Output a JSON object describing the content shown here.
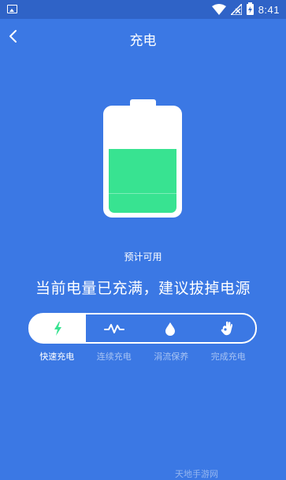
{
  "status_bar": {
    "time": "8:41",
    "icons": [
      "image-icon",
      "wifi-icon",
      "signal-icon",
      "battery-icon"
    ]
  },
  "header": {
    "title": "充电"
  },
  "battery": {
    "level": 0.62,
    "fill_color": "#38e391",
    "estimate_label": "预计可用"
  },
  "message": "当前电量已充满，建议拔掉电源",
  "stages": [
    {
      "label": "快速充电",
      "icon": "lightning-icon",
      "active": true
    },
    {
      "label": "连续充电",
      "icon": "pulse-icon",
      "active": false
    },
    {
      "label": "涓流保养",
      "icon": "droplet-icon",
      "active": false
    },
    {
      "label": "完成充电",
      "icon": "ok-hand-icon",
      "active": false
    }
  ],
  "colors": {
    "background": "#3b78e4",
    "status_bar": "#2f63c7",
    "accent": "#38e391"
  },
  "watermark": "天地手游网"
}
